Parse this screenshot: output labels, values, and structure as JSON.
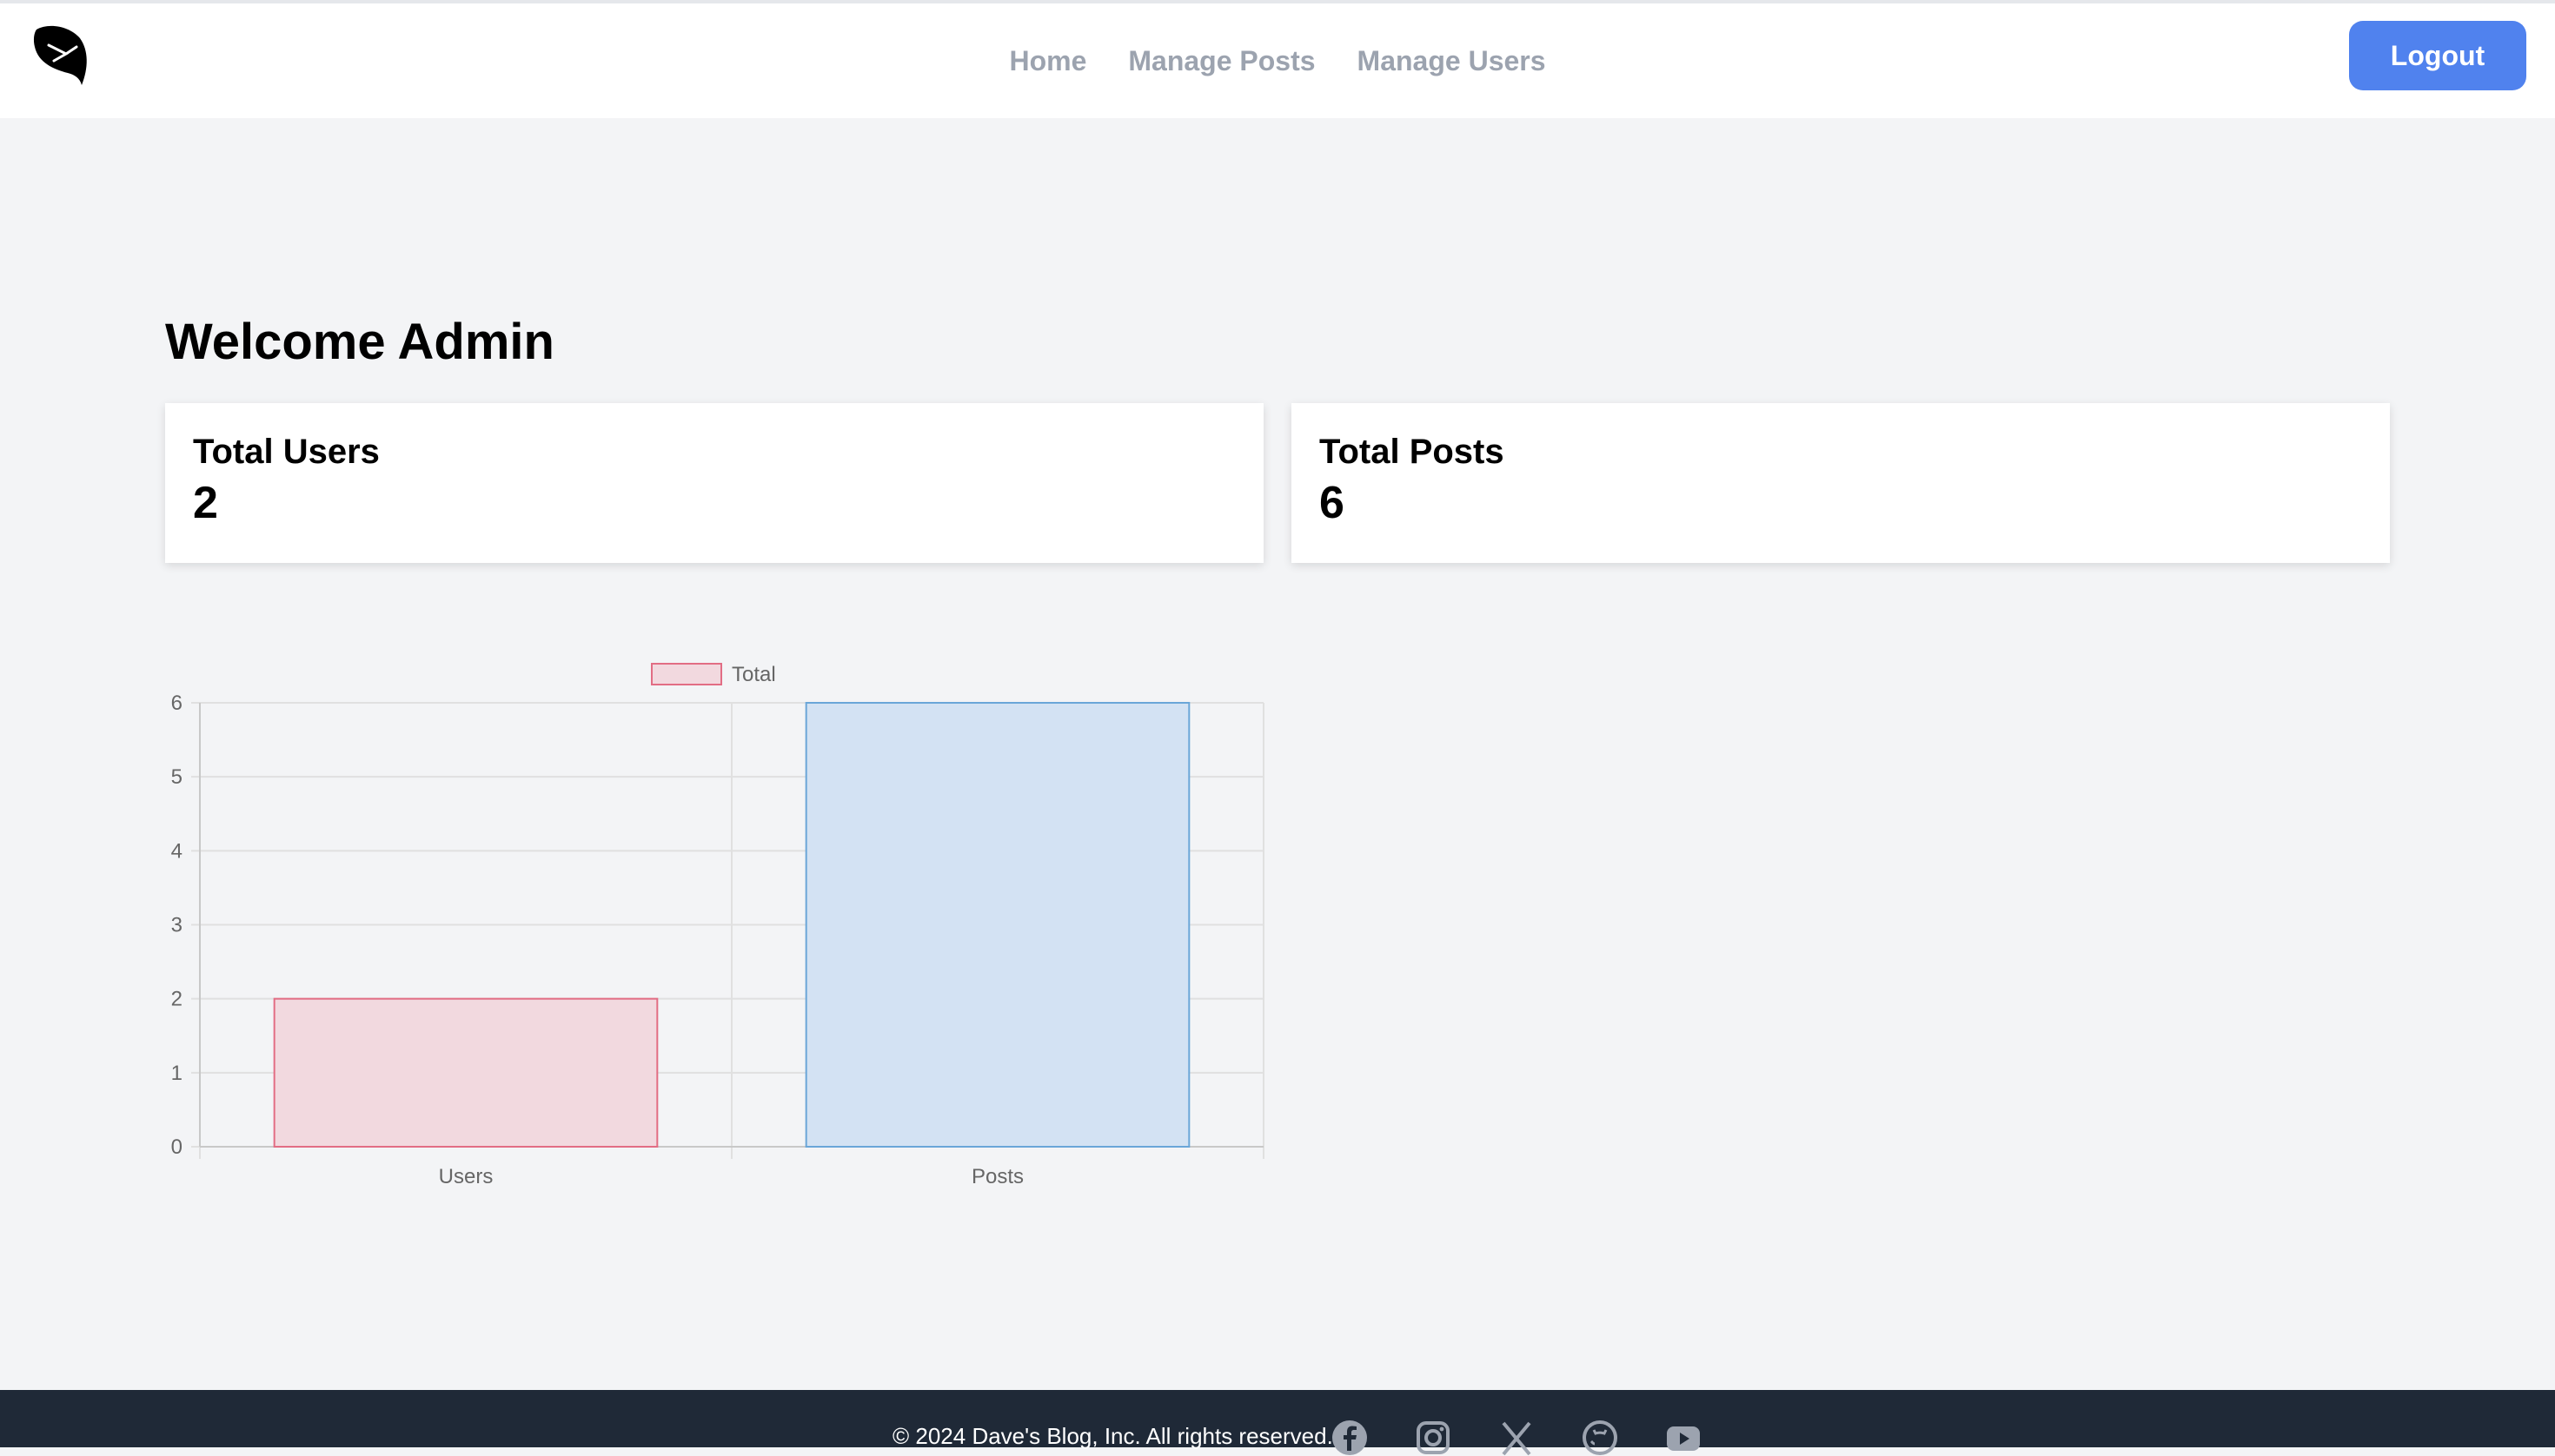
{
  "header": {
    "nav": {
      "home": "Home",
      "manage_posts": "Manage Posts",
      "manage_users": "Manage Users"
    },
    "logout_label": "Logout",
    "logo_icon": "bird-leaf-logo-icon"
  },
  "main": {
    "welcome": "Welcome Admin",
    "cards": {
      "users": {
        "label": "Total Users",
        "value": "2"
      },
      "posts": {
        "label": "Total Posts",
        "value": "6"
      }
    }
  },
  "chart_data": {
    "type": "bar",
    "categories": [
      "Users",
      "Posts"
    ],
    "series": [
      {
        "name": "Total",
        "values": [
          2,
          6
        ]
      }
    ],
    "bar_colors": [
      "#f2d9df",
      "#d3e2f3"
    ],
    "bar_border_colors": [
      "#e26d84",
      "#6aa6d8"
    ],
    "ylim": [
      0,
      6
    ],
    "yticks": [
      "0",
      "1",
      "2",
      "3",
      "4",
      "5",
      "6"
    ],
    "grid": true,
    "legend": "top"
  },
  "footer": {
    "copyright": "© 2024 Dave's Blog, Inc. All rights reserved.",
    "social_icons": [
      "facebook-icon",
      "instagram-icon",
      "x-icon",
      "github-icon",
      "youtube-icon"
    ]
  },
  "colors": {
    "accent": "#5082ee",
    "footer_bg": "#1f2937",
    "nav_text": "#9ca3af"
  }
}
